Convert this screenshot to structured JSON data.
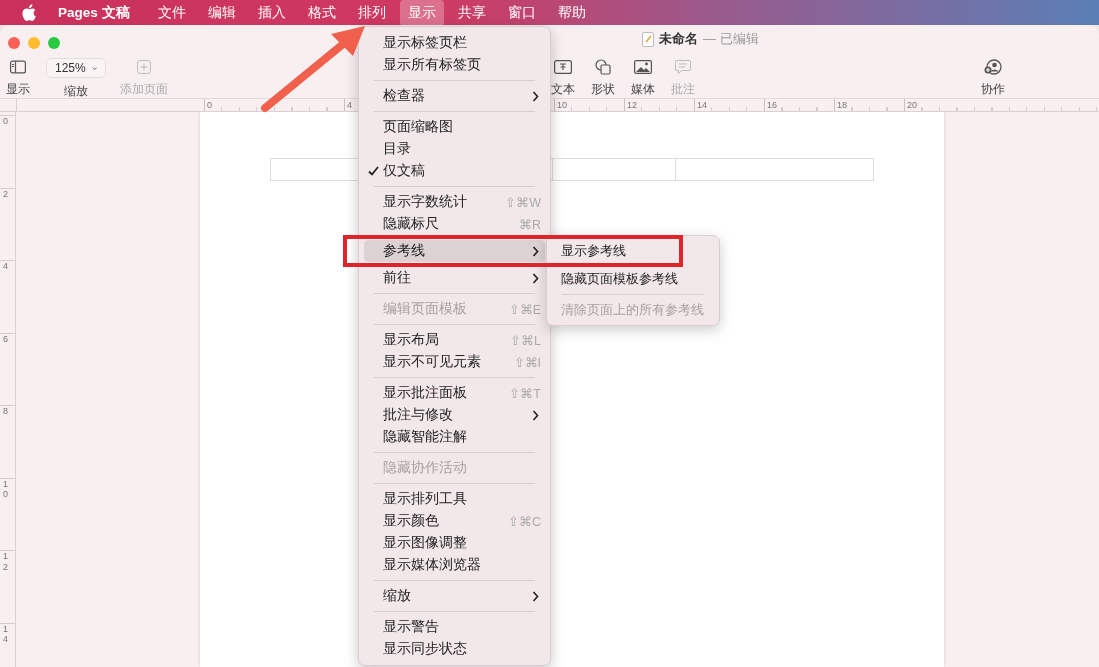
{
  "menubar": {
    "app": "Pages 文稿",
    "items": [
      {
        "label": "文件",
        "selected": false
      },
      {
        "label": "编辑",
        "selected": false
      },
      {
        "label": "插入",
        "selected": false
      },
      {
        "label": "格式",
        "selected": false
      },
      {
        "label": "排列",
        "selected": false
      },
      {
        "label": "显示",
        "selected": true
      },
      {
        "label": "共享",
        "selected": false
      },
      {
        "label": "窗口",
        "selected": false
      },
      {
        "label": "帮助",
        "selected": false
      }
    ]
  },
  "window": {
    "title": "未命名",
    "status": "— 已编辑"
  },
  "toolbar": {
    "left": [
      {
        "kind": "sidebar",
        "label": "显示",
        "disabled": false
      },
      {
        "kind": "zoom",
        "label": "缩放",
        "value": "125%",
        "disabled": false
      },
      {
        "kind": "add",
        "label": "添加页面",
        "disabled": true
      }
    ],
    "middle": [
      {
        "kind": "text",
        "label": "文本",
        "disabled": false
      },
      {
        "kind": "shape",
        "label": "形状",
        "disabled": false
      },
      {
        "kind": "media",
        "label": "媒体",
        "disabled": false
      },
      {
        "kind": "comment",
        "label": "批注",
        "disabled": true
      }
    ],
    "right": [
      {
        "kind": "collaborate",
        "label": "协作",
        "disabled": false
      }
    ]
  },
  "ruler": {
    "horizontal": [
      "0",
      "4",
      "10",
      "12",
      "14",
      "16",
      "18",
      "20"
    ],
    "vertical": [
      "0",
      "2",
      "4",
      "6",
      "8",
      "10",
      "12",
      "14"
    ]
  },
  "view_menu": [
    {
      "kind": "item",
      "label": "显示标签页栏",
      "submenu": false,
      "checked": false,
      "disabled": false,
      "selected": false
    },
    {
      "kind": "item",
      "label": "显示所有标签页",
      "submenu": false,
      "checked": false,
      "disabled": false,
      "selected": false
    },
    {
      "kind": "separator"
    },
    {
      "kind": "item",
      "label": "检查器",
      "submenu": true,
      "checked": false,
      "disabled": false,
      "selected": false
    },
    {
      "kind": "separator"
    },
    {
      "kind": "item",
      "label": "页面缩略图",
      "submenu": false,
      "checked": false,
      "disabled": false,
      "selected": false
    },
    {
      "kind": "item",
      "label": "目录",
      "submenu": false,
      "checked": false,
      "disabled": false,
      "selected": false
    },
    {
      "kind": "item",
      "label": "仅文稿",
      "submenu": false,
      "checked": true,
      "disabled": false,
      "selected": false
    },
    {
      "kind": "separator"
    },
    {
      "kind": "item",
      "label": "显示字数统计",
      "shortcut": "⇧⌘W",
      "submenu": false,
      "checked": false,
      "disabled": false,
      "selected": false
    },
    {
      "kind": "item",
      "label": "隐藏标尺",
      "shortcut": "⌘R",
      "submenu": false,
      "checked": false,
      "disabled": false,
      "selected": false
    },
    {
      "kind": "item",
      "label": "参考线",
      "submenu": true,
      "checked": false,
      "disabled": false,
      "selected": true
    },
    {
      "kind": "item",
      "label": "前往",
      "submenu": true,
      "checked": false,
      "disabled": false,
      "selected": false
    },
    {
      "kind": "separator"
    },
    {
      "kind": "item",
      "label": "编辑页面模板",
      "shortcut": "⇧⌘E",
      "submenu": false,
      "checked": false,
      "disabled": true,
      "selected": false
    },
    {
      "kind": "separator"
    },
    {
      "kind": "item",
      "label": "显示布局",
      "shortcut": "⇧⌘L",
      "submenu": false,
      "checked": false,
      "disabled": false,
      "selected": false
    },
    {
      "kind": "item",
      "label": "显示不可见元素",
      "shortcut": "⇧⌘I",
      "submenu": false,
      "checked": false,
      "disabled": false,
      "selected": false
    },
    {
      "kind": "separator"
    },
    {
      "kind": "item",
      "label": "显示批注面板",
      "shortcut": "⇧⌘T",
      "submenu": false,
      "checked": false,
      "disabled": false,
      "selected": false
    },
    {
      "kind": "item",
      "label": "批注与修改",
      "submenu": true,
      "checked": false,
      "disabled": false,
      "selected": false
    },
    {
      "kind": "item",
      "label": "隐藏智能注解",
      "submenu": false,
      "checked": false,
      "disabled": false,
      "selected": false
    },
    {
      "kind": "separator"
    },
    {
      "kind": "item",
      "label": "隐藏协作活动",
      "submenu": false,
      "checked": false,
      "disabled": true,
      "selected": false
    },
    {
      "kind": "separator"
    },
    {
      "kind": "item",
      "label": "显示排列工具",
      "submenu": false,
      "checked": false,
      "disabled": false,
      "selected": false
    },
    {
      "kind": "item",
      "label": "显示颜色",
      "shortcut": "⇧⌘C",
      "submenu": false,
      "checked": false,
      "disabled": false,
      "selected": false
    },
    {
      "kind": "item",
      "label": "显示图像调整",
      "submenu": false,
      "checked": false,
      "disabled": false,
      "selected": false
    },
    {
      "kind": "item",
      "label": "显示媒体浏览器",
      "submenu": false,
      "checked": false,
      "disabled": false,
      "selected": false
    },
    {
      "kind": "separator"
    },
    {
      "kind": "item",
      "label": "缩放",
      "submenu": true,
      "checked": false,
      "disabled": false,
      "selected": false
    },
    {
      "kind": "separator"
    },
    {
      "kind": "item",
      "label": "显示警告",
      "submenu": false,
      "checked": false,
      "disabled": false,
      "selected": false
    },
    {
      "kind": "item",
      "label": "显示同步状态",
      "submenu": false,
      "checked": false,
      "disabled": false,
      "selected": false
    }
  ],
  "guides_submenu": [
    {
      "kind": "item",
      "label": "显示参考线",
      "disabled": false
    },
    {
      "kind": "item",
      "label": "隐藏页面模板参考线",
      "disabled": false
    },
    {
      "kind": "separator"
    },
    {
      "kind": "item",
      "label": "清除页面上的所有参考线",
      "disabled": true
    }
  ]
}
